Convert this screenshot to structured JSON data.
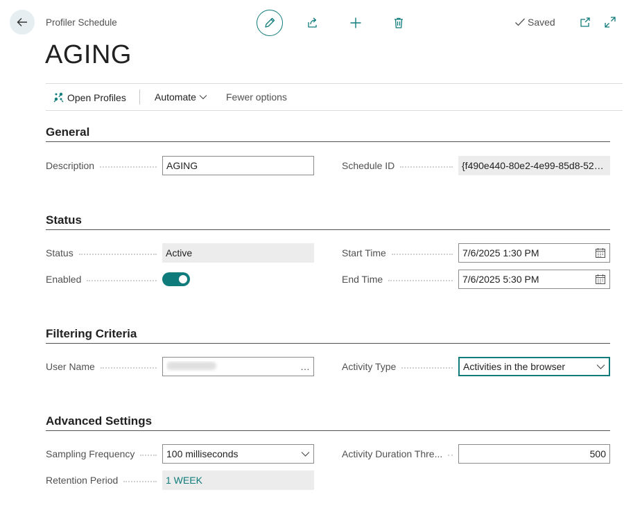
{
  "header": {
    "caption": "Profiler Schedule",
    "title": "AGING",
    "saved_label": "Saved",
    "icons": {
      "back": "back-arrow-icon",
      "edit": "pencil-icon",
      "share": "share-icon",
      "new": "plus-icon",
      "delete": "trash-icon",
      "saved": "checkmark-icon",
      "popout": "open-in-new-window-icon",
      "expand": "expand-diagonal-icon"
    },
    "accent_color": "#0f7b7b"
  },
  "action_bar": {
    "open_profiles": "Open Profiles",
    "automate": "Automate",
    "fewer_options": "Fewer options"
  },
  "general": {
    "title": "General",
    "description_label": "Description",
    "description_value": "AGING",
    "schedule_id_label": "Schedule ID",
    "schedule_id_value": "{f490e440-80e2-4e99-85d8-52d..."
  },
  "status": {
    "title": "Status",
    "status_label": "Status",
    "status_value": "Active",
    "enabled_label": "Enabled",
    "enabled_value": true,
    "start_time_label": "Start Time",
    "start_time_value": "7/6/2025 1:30 PM",
    "end_time_label": "End Time",
    "end_time_value": "7/6/2025 5:30 PM"
  },
  "filtering": {
    "title": "Filtering Criteria",
    "user_name_label": "User Name",
    "user_name_lookup": "…",
    "activity_type_label": "Activity Type",
    "activity_type_value": "Activities in the browser"
  },
  "advanced": {
    "title": "Advanced Settings",
    "sampling_label": "Sampling Frequency",
    "sampling_value": "100 milliseconds",
    "duration_label": "Activity Duration Thre...",
    "duration_value": "500",
    "retention_label": "Retention Period",
    "retention_value": "1 WEEK"
  }
}
